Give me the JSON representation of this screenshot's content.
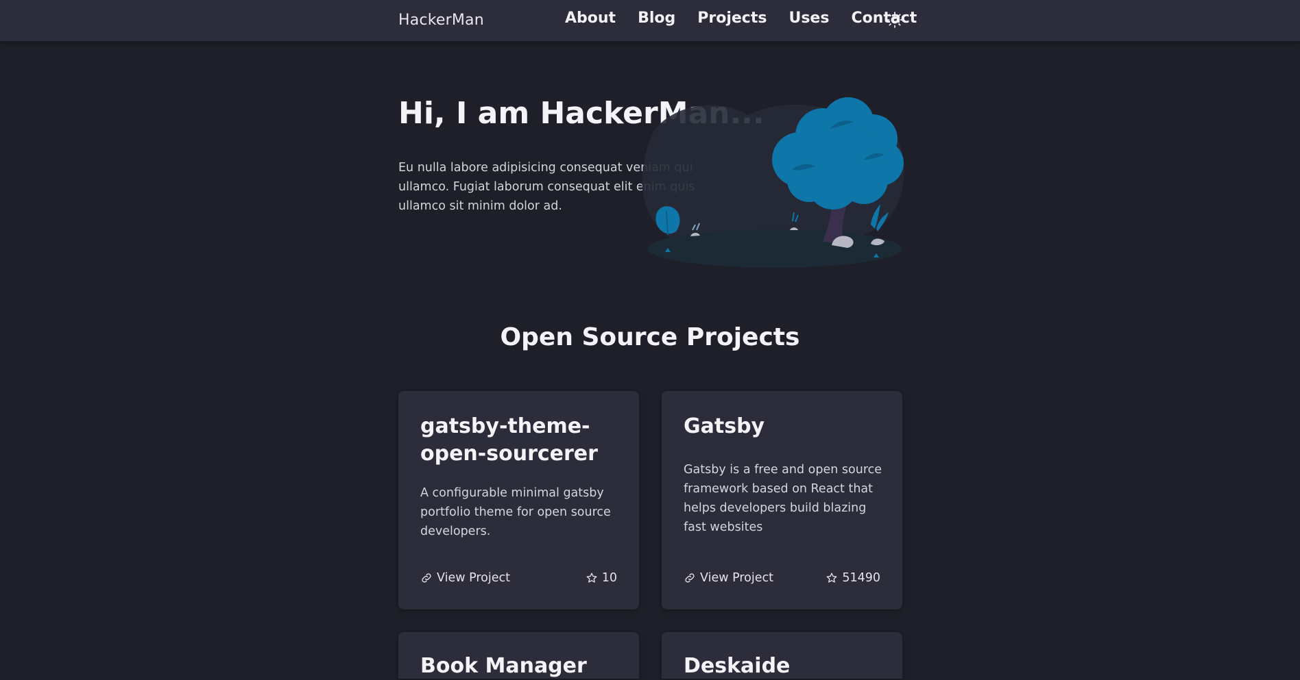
{
  "header": {
    "brand": "HackerMan",
    "nav": [
      "About",
      "Blog",
      "Projects",
      "Uses",
      "Contact"
    ],
    "theme_icon": "sun-icon"
  },
  "hero": {
    "title": "Hi, I am HackerMan...",
    "text": "Eu nulla labore adipisicing consequat veniam qui ullamco. Fugiat laborum consequat elit enim quis ullamco sit minim dolor ad.",
    "illustration_color": "#0e76a8"
  },
  "projects": {
    "title": "Open Source Projects",
    "cards": [
      {
        "title": "gatsby-theme-open-sourcerer",
        "description": "A configurable minimal gatsby portfolio theme for open source developers.",
        "link_label": "View Project",
        "stars": "10"
      },
      {
        "title": "Gatsby",
        "description": "Gatsby is a free and open source framework based on React that helps developers build blazing fast websites",
        "link_label": "View Project",
        "stars": "51490"
      },
      {
        "title": "Book Manager"
      },
      {
        "title": "Deskaide"
      }
    ]
  },
  "colors": {
    "background": "#1f1f29",
    "surface": "#2c2c3a",
    "accent": "#0e76a8",
    "text": "#f4f4f8"
  }
}
